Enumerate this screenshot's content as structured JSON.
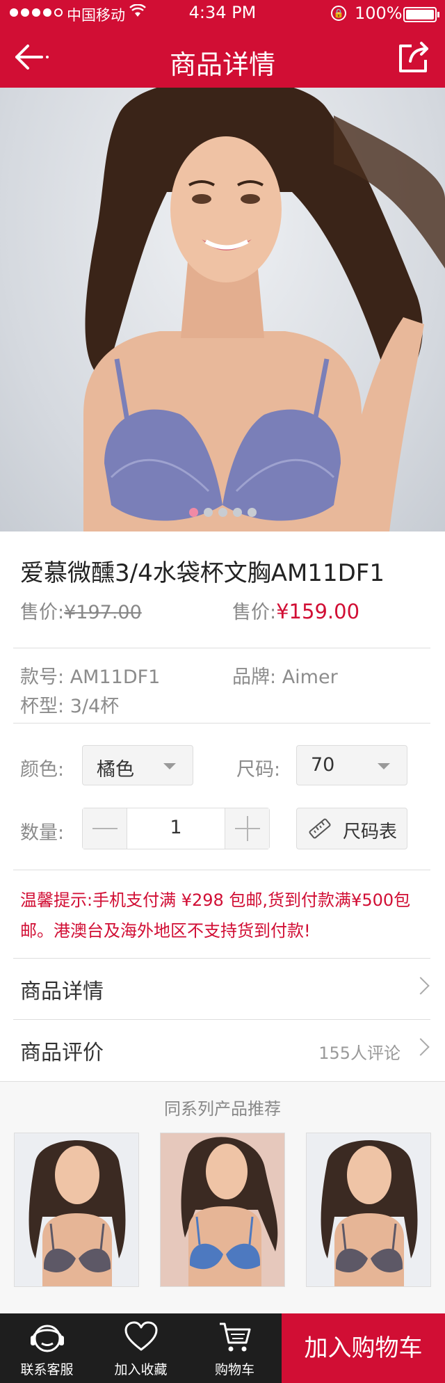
{
  "status_bar": {
    "carrier": "中国移动",
    "time": "4:34 PM",
    "battery": "100%"
  },
  "header": {
    "title": "商品详情"
  },
  "gallery": {
    "slides": 5,
    "active_index": 0
  },
  "product": {
    "name": "爱慕微醺3/4水袋杯文胸AM11DF1",
    "old_price_label": "售价:",
    "old_price": "¥197.00",
    "new_price_label": "售价:",
    "new_price": "¥159.00",
    "style_no_label": "款号:",
    "style_no": "AM11DF1",
    "brand_label": "品牌:",
    "brand": "Aimer",
    "cup_label": "杯型:",
    "cup": "3/4杯"
  },
  "options": {
    "color_label": "颜色:",
    "color_value": "橘色",
    "size_label": "尺码:",
    "size_value": "70",
    "qty_label": "数量:",
    "qty_value": "1",
    "size_chart_label": "尺码表"
  },
  "notice": "温馨提示:手机支付满 ¥298 包邮,货到付款满¥500包邮。港澳台及海外地区不支持货到付款!",
  "links": {
    "details": "商品详情",
    "reviews": "商品评价",
    "reviews_count": "155人评论"
  },
  "recommend": {
    "title": "同系列产品推荐",
    "items": [
      {
        "color": "#5d5866"
      },
      {
        "color": "#4d79c0"
      },
      {
        "color": "#5d5866"
      }
    ]
  },
  "bottom_bar": {
    "service": "联系客服",
    "favorite": "加入收藏",
    "cart": "购物车",
    "add_to_cart": "加入购物车"
  },
  "colors": {
    "brand": "#d10e34",
    "bottom_bar_bg": "#1e1e1e"
  }
}
